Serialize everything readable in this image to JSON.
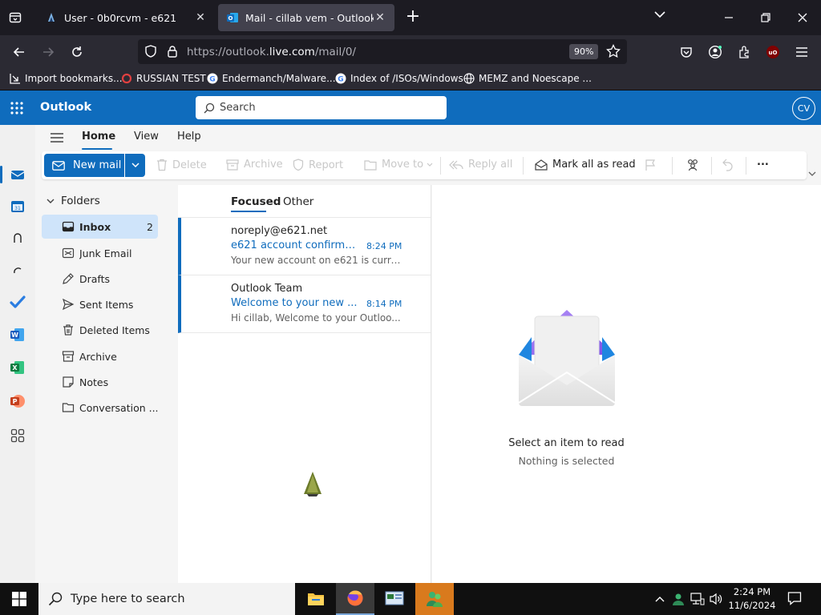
{
  "browser": {
    "tabs": [
      {
        "title": "User - 0b0rcvm - e621",
        "active": false
      },
      {
        "title": "Mail - cillab vem - Outlook",
        "active": true
      }
    ],
    "url_prefix": "https://outlook.",
    "url_host": "live.com",
    "url_path": "/mail/0/",
    "zoom": "90%",
    "extension_badge": "uO",
    "bookmarks": [
      {
        "label": "Import bookmarks...",
        "icon": "import-icon"
      },
      {
        "label": "RUSSIAN TEST",
        "icon": "ring-icon"
      },
      {
        "label": "Endermanch/Malware...",
        "icon": "google-icon"
      },
      {
        "label": "Index of /ISOs/Windows",
        "icon": "google-icon"
      },
      {
        "label": "MEMZ and Noescape ...",
        "icon": "globe-icon"
      }
    ]
  },
  "outlook": {
    "brand": "Outlook",
    "search_placeholder": "Search",
    "avatar_initials": "CV",
    "ribbon_tabs": [
      "Home",
      "View",
      "Help"
    ],
    "ribbon": {
      "new_mail": "New mail",
      "delete": "Delete",
      "archive": "Archive",
      "report": "Report",
      "move_to": "Move to",
      "reply_all": "Reply all",
      "mark_all_read": "Mark all as read",
      "more": "..."
    },
    "folders_header": "Folders",
    "folders": [
      {
        "name": "Inbox",
        "count": "2",
        "icon": "inbox-icon",
        "selected": true
      },
      {
        "name": "Junk Email",
        "count": "",
        "icon": "junk-icon",
        "selected": false
      },
      {
        "name": "Drafts",
        "count": "",
        "icon": "drafts-icon",
        "selected": false
      },
      {
        "name": "Sent Items",
        "count": "",
        "icon": "sent-icon",
        "selected": false
      },
      {
        "name": "Deleted Items",
        "count": "",
        "icon": "trash-icon",
        "selected": false
      },
      {
        "name": "Archive",
        "count": "",
        "icon": "archive-icon",
        "selected": false
      },
      {
        "name": "Notes",
        "count": "",
        "icon": "notes-icon",
        "selected": false
      },
      {
        "name": "Conversation ...",
        "count": "",
        "icon": "folder-icon",
        "selected": false
      }
    ],
    "list_tabs": [
      "Focused",
      "Other"
    ],
    "messages": [
      {
        "from": "noreply@e621.net",
        "subject": "e621 account confirmati...",
        "time": "8:24 PM",
        "preview": "Your new account on e621 is curre..."
      },
      {
        "from": "Outlook Team",
        "subject": "Welcome to your new ...",
        "time": "8:14 PM",
        "preview": "Hi cillab, Welcome to your Outloo..."
      }
    ],
    "reading_title": "Select an item to read",
    "reading_subtitle": "Nothing is selected"
  },
  "taskbar": {
    "search_placeholder": "Type here to search",
    "time": "2:24 PM",
    "date": "11/6/2024"
  },
  "colors": {
    "outlook_blue": "#0f6cbd",
    "selected_folder": "#cfe4fa"
  }
}
